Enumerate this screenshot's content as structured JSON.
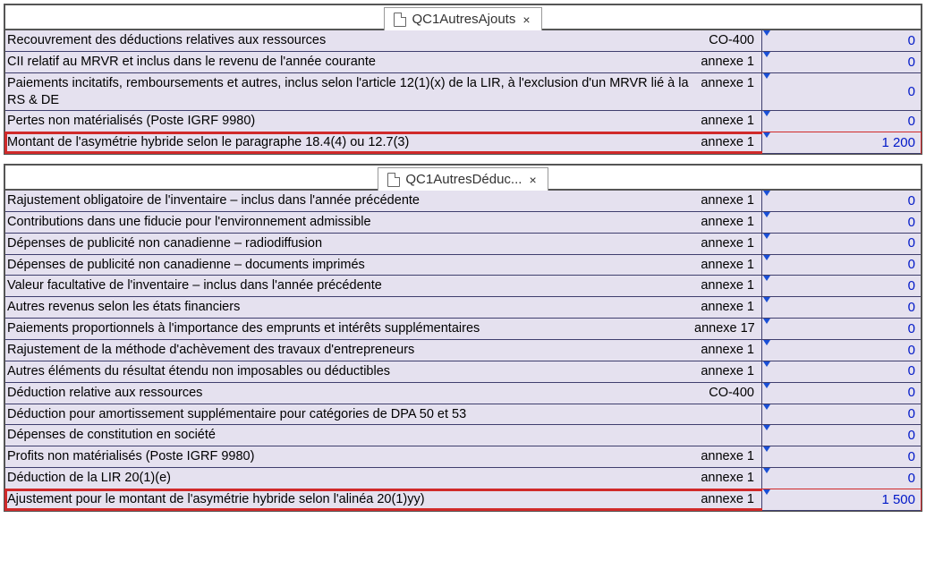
{
  "panel1": {
    "tab_label": "QC1AutresAjouts",
    "rows": [
      {
        "desc": "Recouvrement des déductions relatives aux ressources",
        "ref": "CO-400",
        "val": "0",
        "hi": false
      },
      {
        "desc": "CII relatif au MRVR et inclus dans le revenu de l'année courante",
        "ref": "annexe 1",
        "val": "0",
        "hi": false
      },
      {
        "desc": "Paiements incitatifs, remboursements et autres, inclus selon l'article 12(1)(x) de la LIR, à l'exclusion d'un MRVR lié à la RS & DE",
        "ref": "annexe 1",
        "val": "0",
        "hi": false
      },
      {
        "desc": "Pertes non matérialisés (Poste IGRF 9980)",
        "ref": "annexe 1",
        "val": "0",
        "hi": false
      },
      {
        "desc": "Montant de l'asymétrie hybride selon le paragraphe 18.4(4) ou 12.7(3)",
        "ref": "annexe 1",
        "val": "1 200",
        "hi": true
      }
    ]
  },
  "panel2": {
    "tab_label": "QC1AutresDéduc...",
    "rows": [
      {
        "desc": "Rajustement obligatoire de l'inventaire – inclus dans l'année précédente",
        "ref": "annexe 1",
        "val": "0",
        "hi": false
      },
      {
        "desc": "Contributions dans une fiducie pour l'environnement admissible",
        "ref": "annexe 1",
        "val": "0",
        "hi": false
      },
      {
        "desc": "Dépenses de publicité non canadienne – radiodiffusion",
        "ref": "annexe 1",
        "val": "0",
        "hi": false
      },
      {
        "desc": "Dépenses de publicité non canadienne – documents imprimés",
        "ref": "annexe 1",
        "val": "0",
        "hi": false
      },
      {
        "desc": "Valeur facultative de l'inventaire – inclus dans l'année précédente",
        "ref": "annexe 1",
        "val": "0",
        "hi": false
      },
      {
        "desc": "Autres revenus selon les états financiers",
        "ref": "annexe 1",
        "val": "0",
        "hi": false
      },
      {
        "desc": "Paiements proportionnels à l'importance des emprunts et intérêts supplémentaires",
        "ref": "annexe 17",
        "val": "0",
        "hi": false
      },
      {
        "desc": "Rajustement de la méthode d'achèvement des travaux d'entrepreneurs",
        "ref": "annexe 1",
        "val": "0",
        "hi": false
      },
      {
        "desc": "Autres éléments du résultat étendu non imposables ou déductibles",
        "ref": "annexe 1",
        "val": "0",
        "hi": false
      },
      {
        "desc": "Déduction relative aux ressources",
        "ref": "CO-400",
        "val": "0",
        "hi": false
      },
      {
        "desc": "Déduction pour amortissement supplémentaire pour catégories de DPA 50 et 53",
        "ref": "",
        "val": "0",
        "hi": false
      },
      {
        "desc": "Dépenses de constitution en société",
        "ref": "",
        "val": "0",
        "hi": false
      },
      {
        "desc": "Profits non matérialisés (Poste IGRF 9980)",
        "ref": "annexe 1",
        "val": "0",
        "hi": false
      },
      {
        "desc": "Déduction de la LIR 20(1)(e)",
        "ref": "annexe 1",
        "val": "0",
        "hi": false
      },
      {
        "desc": "Ajustement pour le montant de l'asymétrie hybride selon l'alinéa 20(1)yy)",
        "ref": "annexe 1",
        "val": "1 500",
        "hi": true
      }
    ]
  }
}
